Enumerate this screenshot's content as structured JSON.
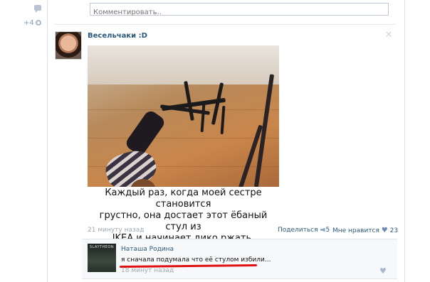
{
  "comment_input": {
    "placeholder": "Комментировать.."
  },
  "sidebar": {
    "likes_extra": "+4"
  },
  "post": {
    "author": "Весельчаки :D",
    "close": "×",
    "caption_lines": [
      "Каждый раз, когда моей сестре становится",
      "грустно, она достает этот ёбаный стул из",
      "IKEA и начинает дико ржать."
    ],
    "time": "21 минуту назад",
    "share_label": "Поделиться",
    "share_count": "5",
    "like_label": "Мне нравится",
    "like_count": "23"
  },
  "reply": {
    "avatar_label": "SLAYTHEON",
    "author": "Наташа Родина",
    "text": "я сначала подумала что её стулом избили...",
    "time": "18 минут назад"
  },
  "colors": {
    "link": "#2b587a",
    "underline": "#e01010"
  }
}
